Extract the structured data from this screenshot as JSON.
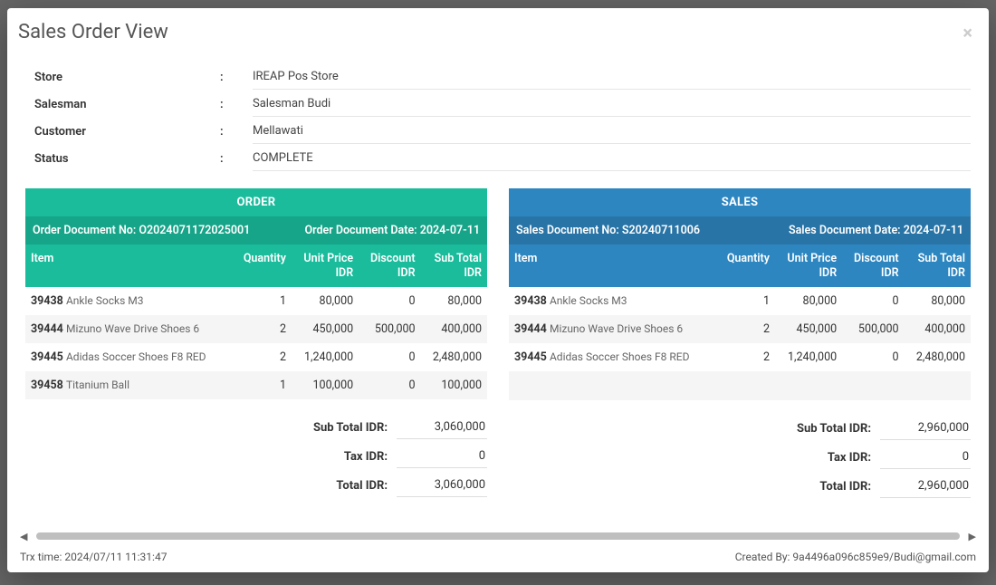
{
  "modal": {
    "title": "Sales Order View",
    "info": {
      "storeLabel": "Store",
      "storeValue": "IREAP Pos Store",
      "salesmanLabel": "Salesman",
      "salesmanValue": "Salesman Budi",
      "customerLabel": "Customer",
      "customerValue": "Mellawati",
      "statusLabel": "Status",
      "statusValue": "COMPLETE"
    },
    "order": {
      "header": "ORDER",
      "docNoLabel": "Order Document No: O2024071172025001",
      "docDateLabel": "Order Document Date: 2024-07-11",
      "cols": {
        "item": "Item",
        "qty": "Quantity",
        "unit": "Unit Price",
        "unitCur": "IDR",
        "disc": "Discount",
        "discCur": "IDR",
        "sub": "Sub Total",
        "subCur": "IDR"
      },
      "rows": [
        {
          "code": "39438",
          "name": "Ankle Socks M3",
          "qty": "1",
          "unit": "80,000",
          "disc": "0",
          "sub": "80,000"
        },
        {
          "code": "39444",
          "name": "Mizuno Wave Drive Shoes 6",
          "qty": "2",
          "unit": "450,000",
          "disc": "500,000",
          "sub": "400,000"
        },
        {
          "code": "39445",
          "name": "Adidas Soccer Shoes F8 RED",
          "qty": "2",
          "unit": "1,240,000",
          "disc": "0",
          "sub": "2,480,000"
        },
        {
          "code": "39458",
          "name": "Titanium Ball",
          "qty": "1",
          "unit": "100,000",
          "disc": "0",
          "sub": "100,000"
        }
      ],
      "totals": {
        "subLabel": "Sub Total IDR:",
        "subValue": "3,060,000",
        "taxLabel": "Tax IDR:",
        "taxValue": "0",
        "totLabel": "Total IDR:",
        "totValue": "3,060,000"
      }
    },
    "sales": {
      "header": "SALES",
      "docNoLabel": "Sales Document No: S20240711006",
      "docDateLabel": "Sales Document Date: 2024-07-11",
      "cols": {
        "item": "Item",
        "qty": "Quantity",
        "unit": "Unit Price",
        "unitCur": "IDR",
        "disc": "Discount",
        "discCur": "IDR",
        "sub": "Sub Total",
        "subCur": "IDR"
      },
      "rows": [
        {
          "code": "39438",
          "name": "Ankle Socks M3",
          "qty": "1",
          "unit": "80,000",
          "disc": "0",
          "sub": "80,000"
        },
        {
          "code": "39444",
          "name": "Mizuno Wave Drive Shoes 6",
          "qty": "2",
          "unit": "450,000",
          "disc": "500,000",
          "sub": "400,000"
        },
        {
          "code": "39445",
          "name": "Adidas Soccer Shoes F8 RED",
          "qty": "2",
          "unit": "1,240,000",
          "disc": "0",
          "sub": "2,480,000"
        }
      ],
      "totals": {
        "subLabel": "Sub Total IDR:",
        "subValue": "2,960,000",
        "taxLabel": "Tax IDR:",
        "taxValue": "0",
        "totLabel": "Total IDR:",
        "totValue": "2,960,000"
      }
    },
    "footer": {
      "left": "Trx time: 2024/07/11 11:31:47",
      "right": "Created By: 9a4496a096c859e9/Budi@gmail.com"
    }
  }
}
